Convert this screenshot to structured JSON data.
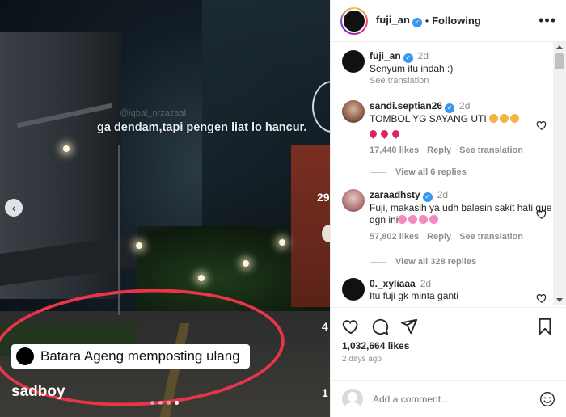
{
  "media": {
    "overlay_text": "ga dendam,tapi pengen liat lo hancur.",
    "watermark": "@iqbal_nrzazaal",
    "repost_text": "Batara Ageng memposting ulang",
    "caption_bottom": "sadboy",
    "side_number": "29",
    "side_number_2": "4",
    "side_number_3": "1",
    "slide_count": 4,
    "active_slide": 4
  },
  "header": {
    "username": "fuji_an",
    "separator": "•",
    "follow_status": "Following",
    "more": "•••"
  },
  "comments": [
    {
      "username": "fuji_an",
      "time": "2d",
      "text": "Senyum itu indah :)",
      "see_translation": "See translation"
    },
    {
      "username": "sandi.septian26",
      "time": "2d",
      "text": "TOMBOL YG SAYANG UTI",
      "likes": "17,440 likes",
      "reply": "Reply",
      "see_translation": "See translation",
      "view_replies": "View all 6 replies"
    },
    {
      "username": "zaraadhsty",
      "time": "2d",
      "text": "Fuji, makasih ya udh balesin sakit hati gue dgn ini",
      "likes": "57,802 likes",
      "reply": "Reply",
      "see_translation": "See translation",
      "view_replies": "View all 328 replies"
    },
    {
      "username": "0._xyliaaa",
      "time": "2d",
      "text": "Itu fuji gk minta ganti"
    }
  ],
  "actions": {
    "likes": "1,032,664 likes",
    "time_ago": "2 days ago"
  },
  "add_comment": {
    "placeholder": "Add a comment..."
  },
  "colors": {
    "verified": "#3897f0",
    "heart": "#e0245e",
    "ellipse": "#e9344a"
  }
}
